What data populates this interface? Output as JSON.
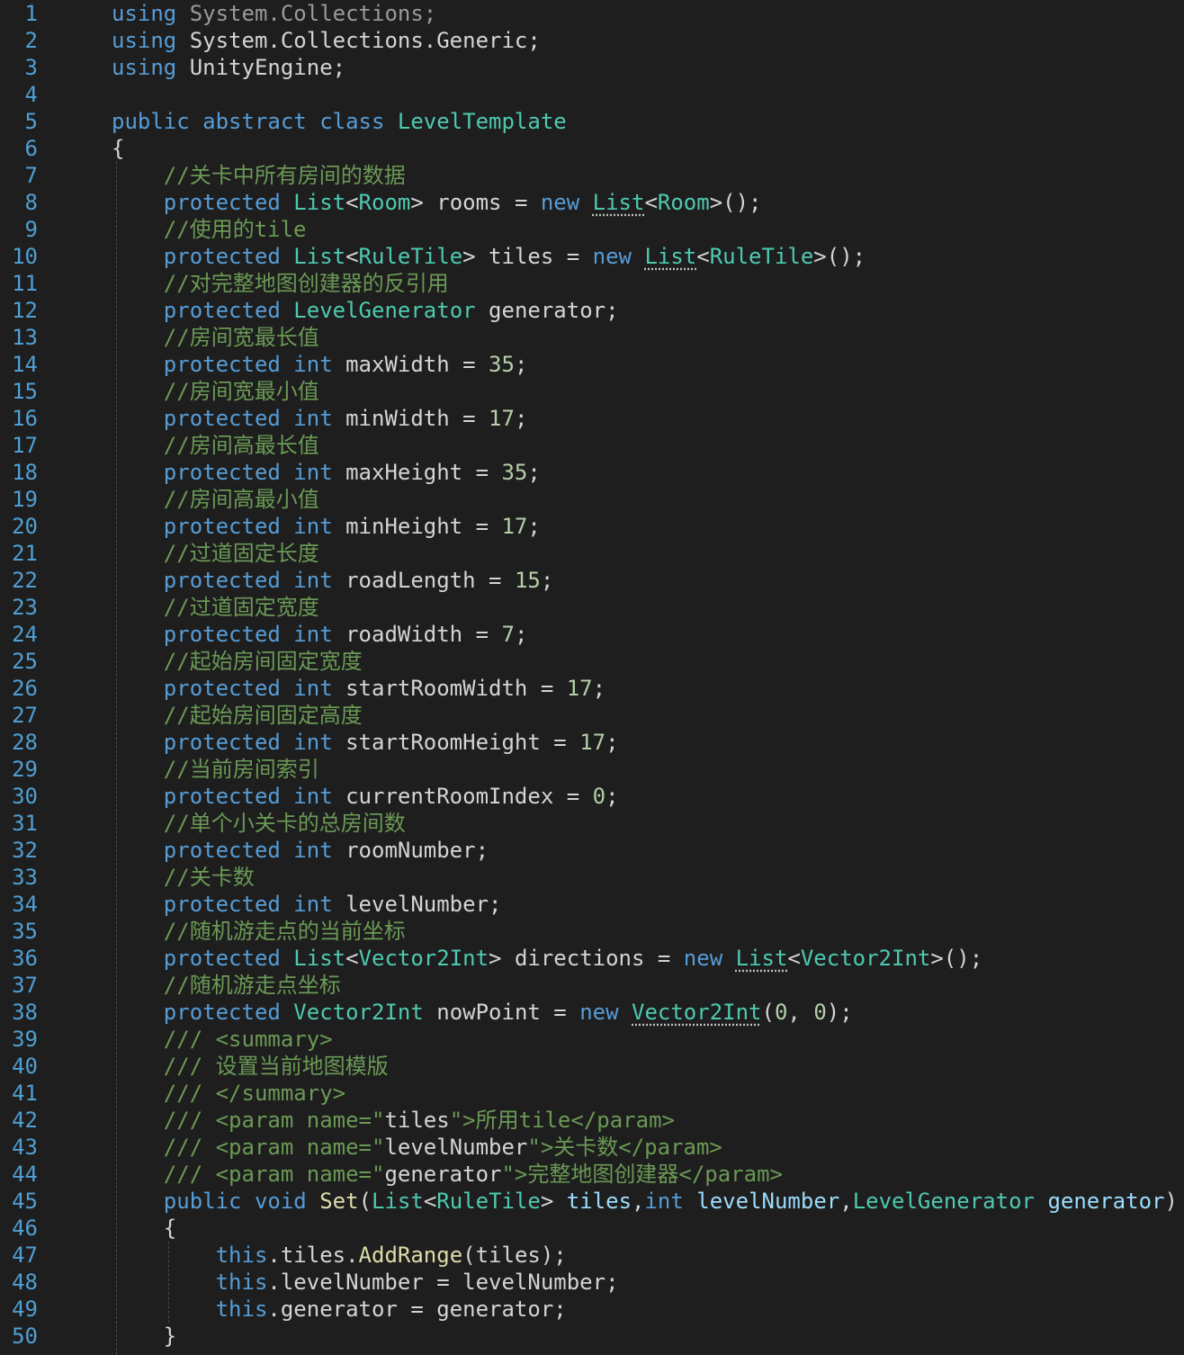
{
  "editor": {
    "colors": {
      "background": "#1e1e1e",
      "line_number": "#4f9fd4",
      "keyword": "#569cd6",
      "type": "#4ec9b0",
      "comment": "#6a9955",
      "number": "#b5cea8",
      "function": "#dcdcaa",
      "parameter": "#9cdcfe",
      "plain": "#d4d4d4"
    },
    "lines": [
      {
        "n": "1",
        "tokens": [
          [
            "kw",
            "using"
          ],
          [
            "pl",
            " "
          ],
          [
            "dim",
            "System.Collections;"
          ]
        ]
      },
      {
        "n": "2",
        "tokens": [
          [
            "kw",
            "using"
          ],
          [
            "pl",
            " System.Collections.Generic;"
          ]
        ]
      },
      {
        "n": "3",
        "tokens": [
          [
            "kw",
            "using"
          ],
          [
            "pl",
            " UnityEngine;"
          ]
        ]
      },
      {
        "n": "4",
        "tokens": []
      },
      {
        "n": "5",
        "tokens": [
          [
            "kw",
            "public abstract class"
          ],
          [
            "pl",
            " "
          ],
          [
            "ty",
            "LevelTemplate"
          ]
        ]
      },
      {
        "n": "6",
        "tokens": [
          [
            "pl",
            "{"
          ]
        ]
      },
      {
        "n": "7",
        "tokens": [
          [
            "pl",
            "    "
          ],
          [
            "cm",
            "//关卡中所有房间的数据"
          ]
        ]
      },
      {
        "n": "8",
        "tokens": [
          [
            "pl",
            "    "
          ],
          [
            "kw",
            "protected"
          ],
          [
            "pl",
            " "
          ],
          [
            "ty",
            "List"
          ],
          [
            "pl",
            "<"
          ],
          [
            "ty",
            "Room"
          ],
          [
            "pl",
            "> rooms = "
          ],
          [
            "kw",
            "new"
          ],
          [
            "pl",
            " "
          ],
          [
            "tysq",
            "List"
          ],
          [
            "pl",
            "<"
          ],
          [
            "ty",
            "Room"
          ],
          [
            "pl",
            ">();"
          ]
        ]
      },
      {
        "n": "9",
        "tokens": [
          [
            "pl",
            "    "
          ],
          [
            "cm",
            "//使用的tile"
          ]
        ]
      },
      {
        "n": "10",
        "tokens": [
          [
            "pl",
            "    "
          ],
          [
            "kw",
            "protected"
          ],
          [
            "pl",
            " "
          ],
          [
            "ty",
            "List"
          ],
          [
            "pl",
            "<"
          ],
          [
            "ty",
            "RuleTile"
          ],
          [
            "pl",
            "> tiles = "
          ],
          [
            "kw",
            "new"
          ],
          [
            "pl",
            " "
          ],
          [
            "tysq",
            "List"
          ],
          [
            "pl",
            "<"
          ],
          [
            "ty",
            "RuleTile"
          ],
          [
            "pl",
            ">();"
          ]
        ]
      },
      {
        "n": "11",
        "tokens": [
          [
            "pl",
            "    "
          ],
          [
            "cm",
            "//对完整地图创建器的反引用"
          ]
        ]
      },
      {
        "n": "12",
        "tokens": [
          [
            "pl",
            "    "
          ],
          [
            "kw",
            "protected"
          ],
          [
            "pl",
            " "
          ],
          [
            "ty",
            "LevelGenerator"
          ],
          [
            "pl",
            " generator;"
          ]
        ]
      },
      {
        "n": "13",
        "tokens": [
          [
            "pl",
            "    "
          ],
          [
            "cm",
            "//房间宽最长值"
          ]
        ]
      },
      {
        "n": "14",
        "tokens": [
          [
            "pl",
            "    "
          ],
          [
            "kw",
            "protected int"
          ],
          [
            "pl",
            " maxWidth = "
          ],
          [
            "num",
            "35"
          ],
          [
            "pl",
            ";"
          ]
        ]
      },
      {
        "n": "15",
        "tokens": [
          [
            "pl",
            "    "
          ],
          [
            "cm",
            "//房间宽最小值"
          ]
        ]
      },
      {
        "n": "16",
        "tokens": [
          [
            "pl",
            "    "
          ],
          [
            "kw",
            "protected int"
          ],
          [
            "pl",
            " minWidth = "
          ],
          [
            "num",
            "17"
          ],
          [
            "pl",
            ";"
          ]
        ]
      },
      {
        "n": "17",
        "tokens": [
          [
            "pl",
            "    "
          ],
          [
            "cm",
            "//房间高最长值"
          ]
        ]
      },
      {
        "n": "18",
        "tokens": [
          [
            "pl",
            "    "
          ],
          [
            "kw",
            "protected int"
          ],
          [
            "pl",
            " maxHeight = "
          ],
          [
            "num",
            "35"
          ],
          [
            "pl",
            ";"
          ]
        ]
      },
      {
        "n": "19",
        "tokens": [
          [
            "pl",
            "    "
          ],
          [
            "cm",
            "//房间高最小值"
          ]
        ]
      },
      {
        "n": "20",
        "tokens": [
          [
            "pl",
            "    "
          ],
          [
            "kw",
            "protected int"
          ],
          [
            "pl",
            " minHeight = "
          ],
          [
            "num",
            "17"
          ],
          [
            "pl",
            ";"
          ]
        ]
      },
      {
        "n": "21",
        "tokens": [
          [
            "pl",
            "    "
          ],
          [
            "cm",
            "//过道固定长度"
          ]
        ]
      },
      {
        "n": "22",
        "tokens": [
          [
            "pl",
            "    "
          ],
          [
            "kw",
            "protected int"
          ],
          [
            "pl",
            " roadLength = "
          ],
          [
            "num",
            "15"
          ],
          [
            "pl",
            ";"
          ]
        ]
      },
      {
        "n": "23",
        "tokens": [
          [
            "pl",
            "    "
          ],
          [
            "cm",
            "//过道固定宽度"
          ]
        ]
      },
      {
        "n": "24",
        "tokens": [
          [
            "pl",
            "    "
          ],
          [
            "kw",
            "protected int"
          ],
          [
            "pl",
            " roadWidth = "
          ],
          [
            "num",
            "7"
          ],
          [
            "pl",
            ";"
          ]
        ]
      },
      {
        "n": "25",
        "tokens": [
          [
            "pl",
            "    "
          ],
          [
            "cm",
            "//起始房间固定宽度"
          ]
        ]
      },
      {
        "n": "26",
        "tokens": [
          [
            "pl",
            "    "
          ],
          [
            "kw",
            "protected int"
          ],
          [
            "pl",
            " startRoomWidth = "
          ],
          [
            "num",
            "17"
          ],
          [
            "pl",
            ";"
          ]
        ]
      },
      {
        "n": "27",
        "tokens": [
          [
            "pl",
            "    "
          ],
          [
            "cm",
            "//起始房间固定高度"
          ]
        ]
      },
      {
        "n": "28",
        "tokens": [
          [
            "pl",
            "    "
          ],
          [
            "kw",
            "protected int"
          ],
          [
            "pl",
            " startRoomHeight = "
          ],
          [
            "num",
            "17"
          ],
          [
            "pl",
            ";"
          ]
        ]
      },
      {
        "n": "29",
        "tokens": [
          [
            "pl",
            "    "
          ],
          [
            "cm",
            "//当前房间索引"
          ]
        ]
      },
      {
        "n": "30",
        "tokens": [
          [
            "pl",
            "    "
          ],
          [
            "kw",
            "protected int"
          ],
          [
            "pl",
            " currentRoomIndex = "
          ],
          [
            "num",
            "0"
          ],
          [
            "pl",
            ";"
          ]
        ]
      },
      {
        "n": "31",
        "tokens": [
          [
            "pl",
            "    "
          ],
          [
            "cm",
            "//单个小关卡的总房间数"
          ]
        ]
      },
      {
        "n": "32",
        "tokens": [
          [
            "pl",
            "    "
          ],
          [
            "kw",
            "protected int"
          ],
          [
            "pl",
            " roomNumber;"
          ]
        ]
      },
      {
        "n": "33",
        "tokens": [
          [
            "pl",
            "    "
          ],
          [
            "cm",
            "//关卡数"
          ]
        ]
      },
      {
        "n": "34",
        "tokens": [
          [
            "pl",
            "    "
          ],
          [
            "kw",
            "protected int"
          ],
          [
            "pl",
            " levelNumber;"
          ]
        ]
      },
      {
        "n": "35",
        "tokens": [
          [
            "pl",
            "    "
          ],
          [
            "cm",
            "//随机游走点的当前坐标"
          ]
        ]
      },
      {
        "n": "36",
        "tokens": [
          [
            "pl",
            "    "
          ],
          [
            "kw",
            "protected"
          ],
          [
            "pl",
            " "
          ],
          [
            "ty",
            "List"
          ],
          [
            "pl",
            "<"
          ],
          [
            "ty",
            "Vector2Int"
          ],
          [
            "pl",
            "> directions = "
          ],
          [
            "kw",
            "new"
          ],
          [
            "pl",
            " "
          ],
          [
            "tysq",
            "List"
          ],
          [
            "pl",
            "<"
          ],
          [
            "ty",
            "Vector2Int"
          ],
          [
            "pl",
            ">();"
          ]
        ]
      },
      {
        "n": "37",
        "tokens": [
          [
            "pl",
            "    "
          ],
          [
            "cm",
            "//随机游走点坐标"
          ]
        ]
      },
      {
        "n": "38",
        "tokens": [
          [
            "pl",
            "    "
          ],
          [
            "kw",
            "protected"
          ],
          [
            "pl",
            " "
          ],
          [
            "ty",
            "Vector2Int"
          ],
          [
            "pl",
            " nowPoint = "
          ],
          [
            "kw",
            "new"
          ],
          [
            "pl",
            " "
          ],
          [
            "tysq",
            "Vector2Int"
          ],
          [
            "pl",
            "("
          ],
          [
            "num",
            "0"
          ],
          [
            "pl",
            ", "
          ],
          [
            "num",
            "0"
          ],
          [
            "pl",
            ");"
          ]
        ]
      },
      {
        "n": "39",
        "tokens": [
          [
            "pl",
            "    "
          ],
          [
            "cm",
            "/// <summary>"
          ]
        ]
      },
      {
        "n": "40",
        "tokens": [
          [
            "pl",
            "    "
          ],
          [
            "cm",
            "/// 设置当前地图模版"
          ]
        ]
      },
      {
        "n": "41",
        "tokens": [
          [
            "pl",
            "    "
          ],
          [
            "cm",
            "/// </summary>"
          ]
        ]
      },
      {
        "n": "42",
        "tokens": [
          [
            "pl",
            "    "
          ],
          [
            "cm",
            "/// <param name=\""
          ],
          [
            "pl",
            "tiles"
          ],
          [
            "cm",
            "\">所用tile</param>"
          ]
        ]
      },
      {
        "n": "43",
        "tokens": [
          [
            "pl",
            "    "
          ],
          [
            "cm",
            "/// <param name=\""
          ],
          [
            "pl",
            "levelNumber"
          ],
          [
            "cm",
            "\">关卡数</param>"
          ]
        ]
      },
      {
        "n": "44",
        "tokens": [
          [
            "pl",
            "    "
          ],
          [
            "cm",
            "/// <param name=\""
          ],
          [
            "pl",
            "generator"
          ],
          [
            "cm",
            "\">完整地图创建器</param>"
          ]
        ]
      },
      {
        "n": "45",
        "tokens": [
          [
            "pl",
            "    "
          ],
          [
            "kw",
            "public void"
          ],
          [
            "pl",
            " "
          ],
          [
            "fn",
            "Set"
          ],
          [
            "pl",
            "("
          ],
          [
            "ty",
            "List"
          ],
          [
            "pl",
            "<"
          ],
          [
            "ty",
            "RuleTile"
          ],
          [
            "pl",
            "> "
          ],
          [
            "pr",
            "tiles"
          ],
          [
            "pl",
            ","
          ],
          [
            "kw",
            "int"
          ],
          [
            "pl",
            " "
          ],
          [
            "pr",
            "levelNumber"
          ],
          [
            "pl",
            ","
          ],
          [
            "ty",
            "LevelGenerator"
          ],
          [
            "pl",
            " "
          ],
          [
            "pr",
            "generator"
          ],
          [
            "pl",
            ")"
          ]
        ]
      },
      {
        "n": "46",
        "tokens": [
          [
            "pl",
            "    {"
          ]
        ]
      },
      {
        "n": "47",
        "tokens": [
          [
            "pl",
            "        "
          ],
          [
            "kw",
            "this"
          ],
          [
            "pl",
            ".tiles."
          ],
          [
            "fn",
            "AddRange"
          ],
          [
            "pl",
            "(tiles);"
          ]
        ]
      },
      {
        "n": "48",
        "tokens": [
          [
            "pl",
            "        "
          ],
          [
            "kw",
            "this"
          ],
          [
            "pl",
            ".levelNumber = levelNumber;"
          ]
        ]
      },
      {
        "n": "49",
        "tokens": [
          [
            "pl",
            "        "
          ],
          [
            "kw",
            "this"
          ],
          [
            "pl",
            ".generator = generator;"
          ]
        ]
      },
      {
        "n": "50",
        "tokens": [
          [
            "pl",
            "    }"
          ]
        ]
      }
    ]
  }
}
